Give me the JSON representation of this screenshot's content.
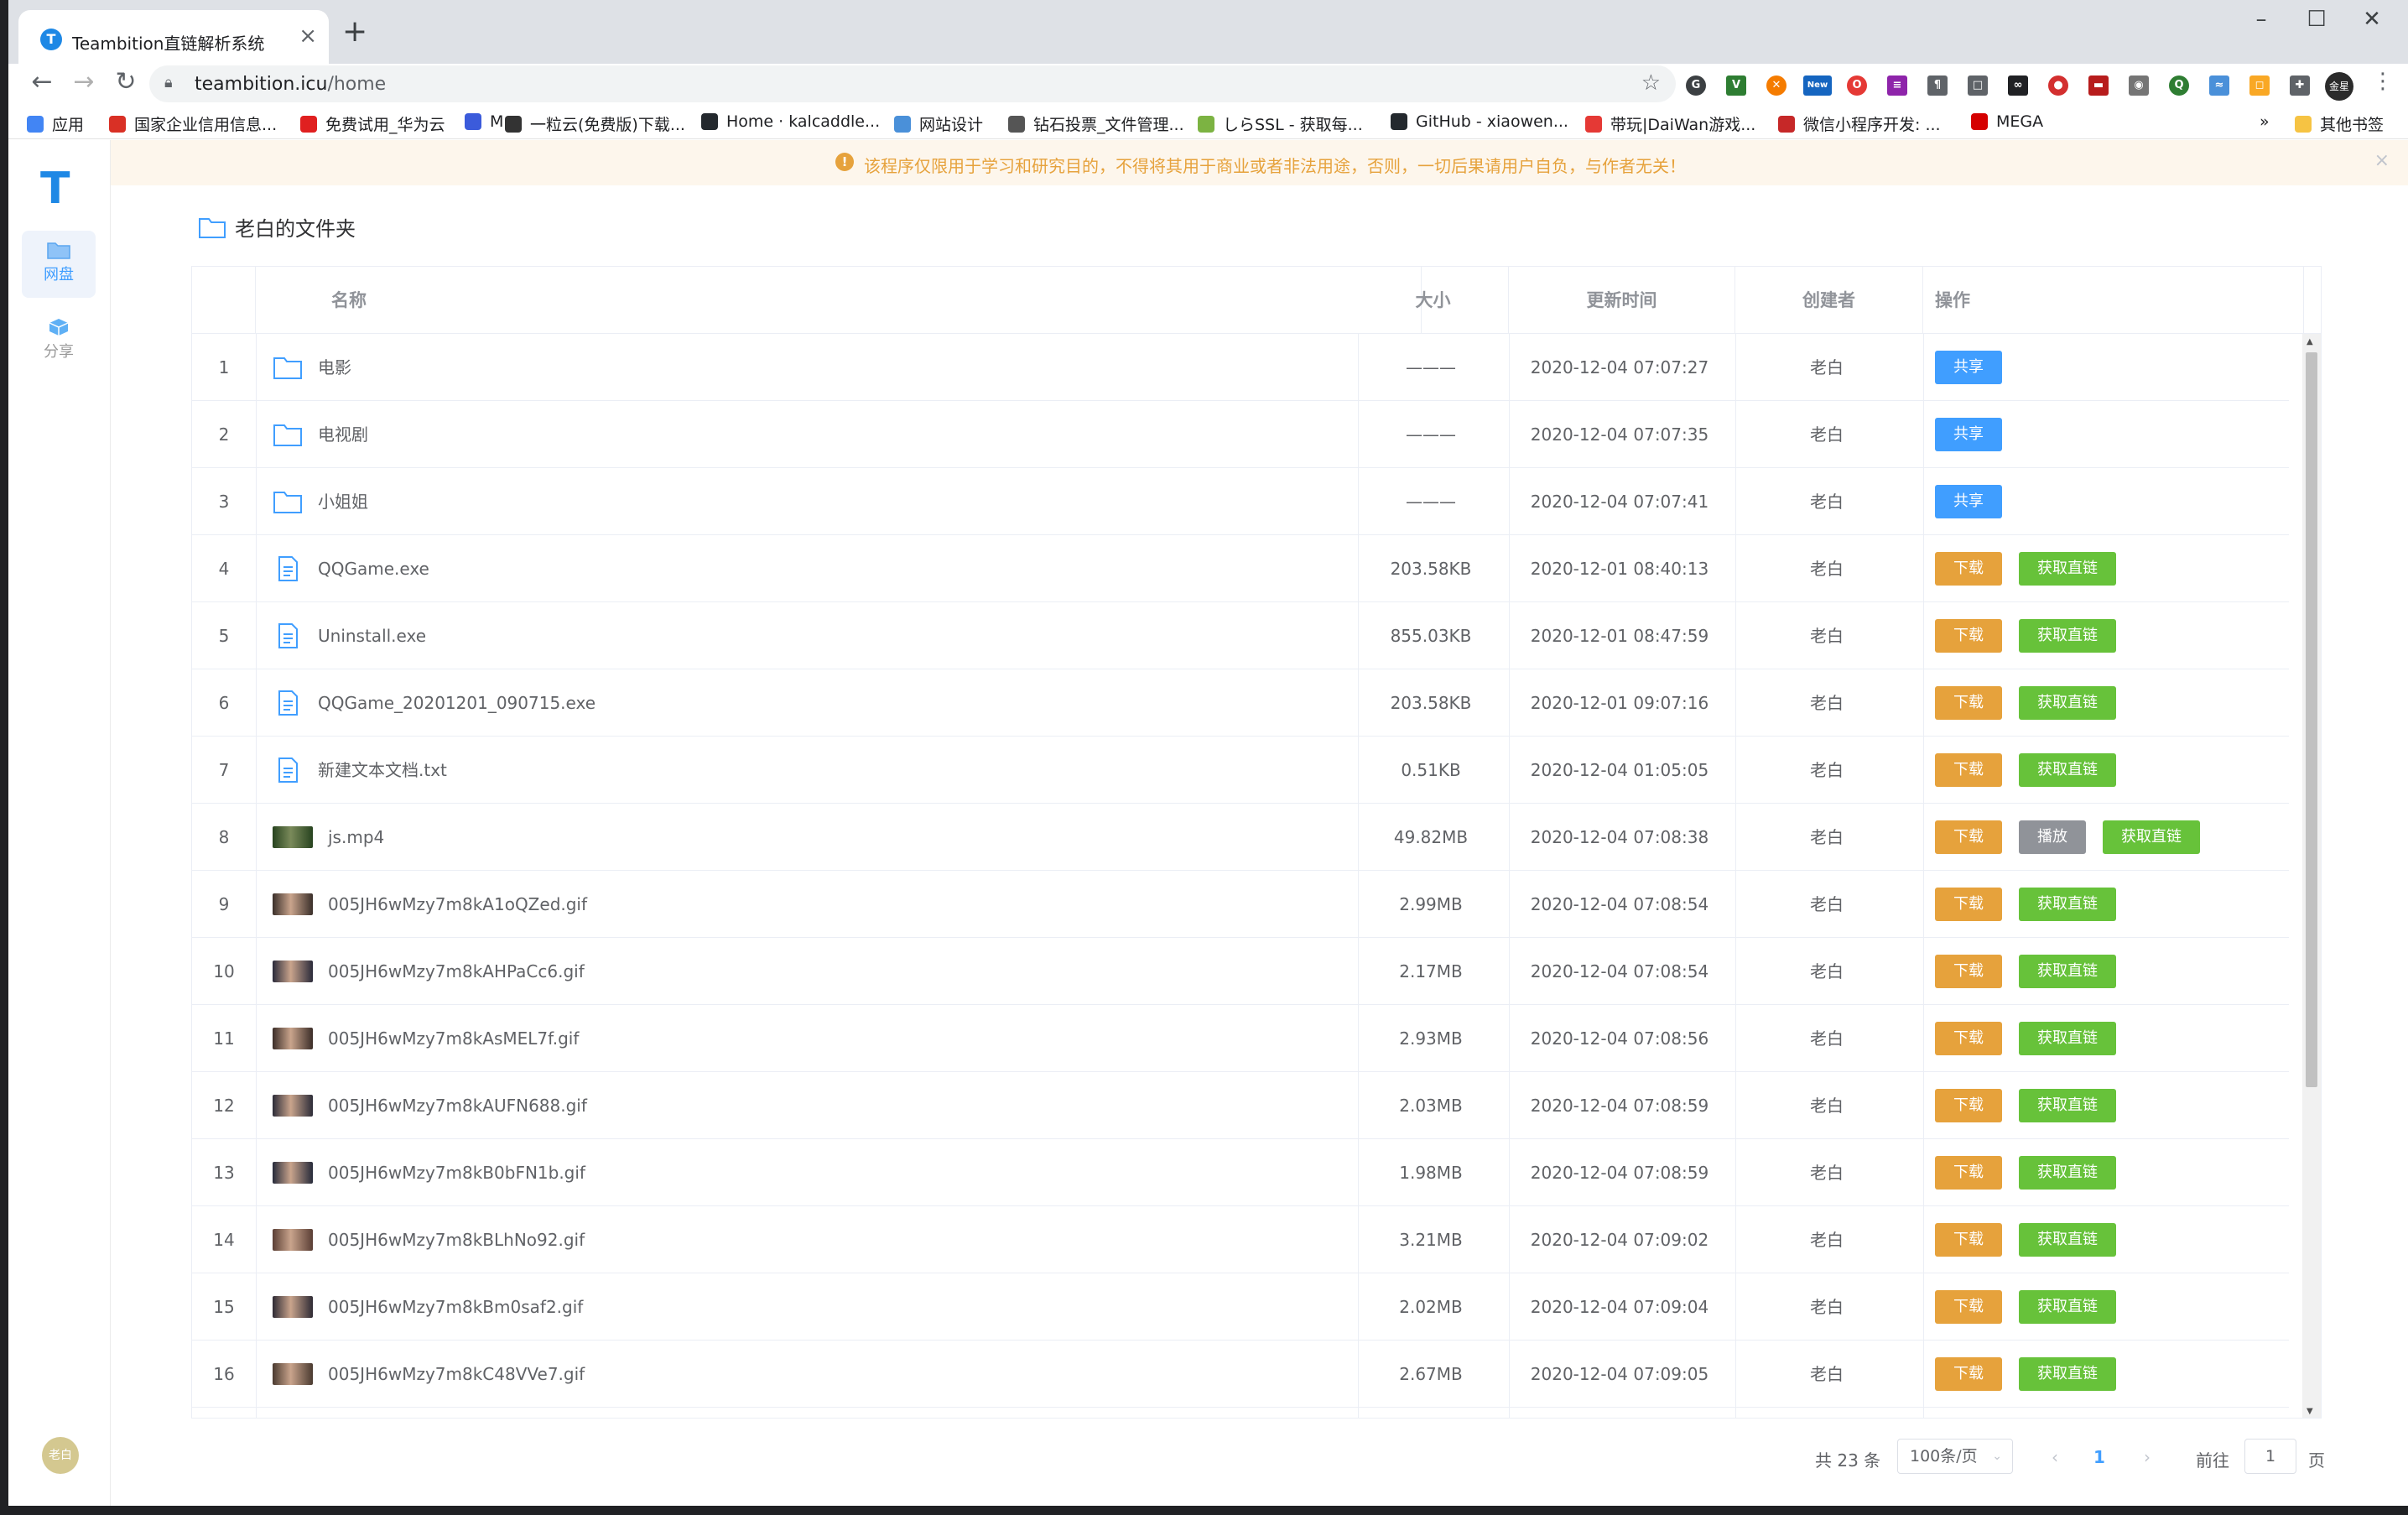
{
  "browser": {
    "tab_title": "Teambition直链解析系统",
    "url_host": "teambition.icu",
    "url_path": "/home",
    "new_badge": "New",
    "profile": "金星",
    "bookmarks": [
      {
        "label": "应用",
        "color": "#4285f4"
      },
      {
        "label": "国家企业信用信息...",
        "color": "#d93025"
      },
      {
        "label": "免费试用_华为云",
        "color": "#e02020"
      },
      {
        "label": "M",
        "color": "#3b5bdb"
      },
      {
        "label": "一粒云(免费版)下载...",
        "color": "#333333"
      },
      {
        "label": "Home · kalcaddle...",
        "color": "#24292e"
      },
      {
        "label": "网站设计",
        "color": "#4a90d9"
      },
      {
        "label": "钻石投票_文件管理...",
        "color": "#555555"
      },
      {
        "label": "しらSSL - 获取每...",
        "color": "#7cb342"
      },
      {
        "label": "GitHub - xiaowen...",
        "color": "#24292e"
      },
      {
        "label": "带玩|DaiWan游戏...",
        "color": "#e53935"
      },
      {
        "label": "微信小程序开发: ...",
        "color": "#c62828"
      },
      {
        "label": "MEGA",
        "color": "#d50000"
      }
    ],
    "bookmarks_more": "»",
    "other_bookmarks": "其他书签"
  },
  "sidebar": {
    "logo": "T",
    "items": [
      {
        "label": "网盘",
        "active": true
      },
      {
        "label": "分享",
        "active": false
      }
    ],
    "avatar": "老白"
  },
  "alert": {
    "text": "该程序仅限用于学习和研究目的，不得将其用于商业或者非法用途，否则，一切后果请用户自负，与作者无关！"
  },
  "folder": {
    "title": "老白的文件夹"
  },
  "table": {
    "headers": {
      "name": "名称",
      "size": "大小",
      "time": "更新时间",
      "creator": "创建者",
      "ops": "操作"
    },
    "buttons": {
      "share": "共享",
      "download": "下载",
      "link": "获取直链",
      "play": "播放"
    },
    "rows": [
      {
        "idx": "1",
        "name": "电影",
        "type": "folder",
        "size": "———",
        "time": "2020-12-04 07:07:27",
        "creator": "老白"
      },
      {
        "idx": "2",
        "name": "电视剧",
        "type": "folder",
        "size": "———",
        "time": "2020-12-04 07:07:35",
        "creator": "老白"
      },
      {
        "idx": "3",
        "name": "小姐姐",
        "type": "folder",
        "size": "———",
        "time": "2020-12-04 07:07:41",
        "creator": "老白"
      },
      {
        "idx": "4",
        "name": "QQGame.exe",
        "type": "file",
        "size": "203.58KB",
        "time": "2020-12-01 08:40:13",
        "creator": "老白"
      },
      {
        "idx": "5",
        "name": "Uninstall.exe",
        "type": "file",
        "size": "855.03KB",
        "time": "2020-12-01 08:47:59",
        "creator": "老白"
      },
      {
        "idx": "6",
        "name": "QQGame_20201201_090715.exe",
        "type": "file",
        "size": "203.58KB",
        "time": "2020-12-01 09:07:16",
        "creator": "老白"
      },
      {
        "idx": "7",
        "name": "新建文本文档.txt",
        "type": "file",
        "size": "0.51KB",
        "time": "2020-12-04 01:05:05",
        "creator": "老白"
      },
      {
        "idx": "8",
        "name": "js.mp4",
        "type": "video",
        "size": "49.82MB",
        "time": "2020-12-04 07:08:38",
        "creator": "老白"
      },
      {
        "idx": "9",
        "name": "005JH6wMzy7m8kA1oQZed.gif",
        "type": "image",
        "size": "2.99MB",
        "time": "2020-12-04 07:08:54",
        "creator": "老白"
      },
      {
        "idx": "10",
        "name": "005JH6wMzy7m8kAHPaCc6.gif",
        "type": "image",
        "size": "2.17MB",
        "time": "2020-12-04 07:08:54",
        "creator": "老白"
      },
      {
        "idx": "11",
        "name": "005JH6wMzy7m8kAsMEL7f.gif",
        "type": "image",
        "size": "2.93MB",
        "time": "2020-12-04 07:08:56",
        "creator": "老白"
      },
      {
        "idx": "12",
        "name": "005JH6wMzy7m8kAUFN688.gif",
        "type": "image",
        "size": "2.03MB",
        "time": "2020-12-04 07:08:59",
        "creator": "老白"
      },
      {
        "idx": "13",
        "name": "005JH6wMzy7m8kB0bFN1b.gif",
        "type": "image",
        "size": "1.98MB",
        "time": "2020-12-04 07:08:59",
        "creator": "老白"
      },
      {
        "idx": "14",
        "name": "005JH6wMzy7m8kBLhNo92.gif",
        "type": "image",
        "size": "3.21MB",
        "time": "2020-12-04 07:09:02",
        "creator": "老白"
      },
      {
        "idx": "15",
        "name": "005JH6wMzy7m8kBm0saf2.gif",
        "type": "image",
        "size": "2.02MB",
        "time": "2020-12-04 07:09:04",
        "creator": "老白"
      },
      {
        "idx": "16",
        "name": "005JH6wMzy7m8kC48VVe7.gif",
        "type": "image",
        "size": "2.67MB",
        "time": "2020-12-04 07:09:05",
        "creator": "老白"
      }
    ]
  },
  "pagination": {
    "total": "共 23 条",
    "page_size": "100条/页",
    "current_page": "1",
    "goto_prefix": "前往",
    "goto_value": "1",
    "goto_suffix": "页"
  },
  "colors": {
    "primary": "#409eff",
    "warning": "#e6a23c",
    "success": "#67c23a",
    "info": "#909399"
  }
}
